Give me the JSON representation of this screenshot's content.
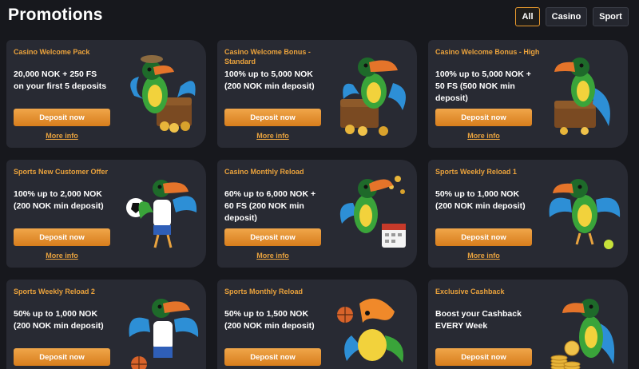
{
  "header": {
    "title": "Promotions",
    "filters": [
      {
        "label": "All",
        "active": true
      },
      {
        "label": "Casino",
        "active": false
      },
      {
        "label": "Sport",
        "active": false
      }
    ]
  },
  "colors": {
    "background": "#17181d",
    "card": "#282a33",
    "accent": "#eaa23c",
    "button": "#e6902f"
  },
  "promotions": [
    {
      "title": "Casino Welcome Pack",
      "description": "20,000 NOK + 250 FS\non your first 5 deposits",
      "button": "Deposit now",
      "link": "More info",
      "art": "toucan-treasure-chest-icon"
    },
    {
      "title": "Casino Welcome Bonus - Standard",
      "description": "100% up to 5,000 NOK\n(200 NOK min deposit)",
      "button": "Deposit now",
      "link": "More info",
      "art": "toucan-treasure-chest-icon"
    },
    {
      "title": "Casino Welcome Bonus - High",
      "description": "100% up to 5,000 NOK +\n50 FS (500 NOK min\ndeposit)",
      "button": "Deposit now",
      "link": "More info",
      "art": "toucan-treasure-chest-icon"
    },
    {
      "title": "Sports New Customer Offer",
      "description": "100% up to 2,000 NOK\n(200 NOK min deposit)",
      "button": "Deposit now",
      "link": "More info",
      "art": "toucan-football-icon"
    },
    {
      "title": "Casino Monthly Reload",
      "description": "60% up to 6,000 NOK +\n60 FS (200 NOK min\ndeposit)",
      "button": "Deposit now",
      "link": "More info",
      "art": "toucan-calendar-icon"
    },
    {
      "title": "Sports Weekly Reload 1",
      "description": "50% up to 1,000 NOK\n(200 NOK min deposit)",
      "button": "Deposit now",
      "link": "More info",
      "art": "toucan-tennis-icon"
    },
    {
      "title": "Sports Weekly Reload 2",
      "description": "50% up to 1,000 NOK\n(200 NOK min deposit)",
      "button": "Deposit now",
      "link": "",
      "art": "toucan-basketball-icon"
    },
    {
      "title": "Sports Monthly Reload",
      "description": "50% up to 1,500 NOK\n(200 NOK min deposit)",
      "button": "Deposit now",
      "link": "",
      "art": "toucan-basketball-icon"
    },
    {
      "title": "Exclusive Cashback",
      "description": "Boost your Cashback\nEVERY Week",
      "button": "Deposit now",
      "link": "",
      "art": "toucan-coins-icon"
    }
  ]
}
